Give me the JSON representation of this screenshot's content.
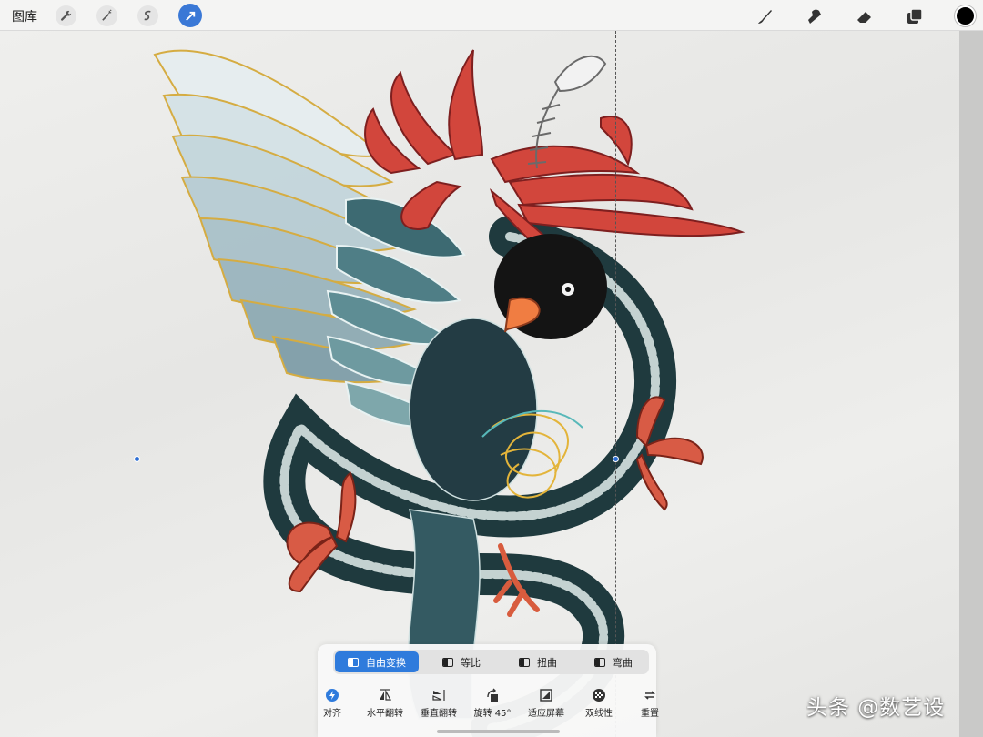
{
  "topbar": {
    "gallery_label": "图库",
    "left_tools": [
      {
        "name": "wrench-icon",
        "active": false
      },
      {
        "name": "magic-wand-icon",
        "active": false
      },
      {
        "name": "selection-icon",
        "active": false
      },
      {
        "name": "transform-arrow-icon",
        "active": true
      }
    ],
    "right_tools": [
      "brush-icon",
      "smudge-icon",
      "eraser-icon",
      "layers-icon"
    ],
    "current_color": "#000000",
    "accent_color": "#2f7bdc"
  },
  "transform": {
    "modes": [
      {
        "label": "自由变换",
        "active": true
      },
      {
        "label": "等比",
        "active": false
      },
      {
        "label": "扭曲",
        "active": false
      },
      {
        "label": "弯曲",
        "active": false
      }
    ],
    "tools": [
      {
        "label": "对齐",
        "icon": "snap-icon"
      },
      {
        "label": "水平翻转",
        "icon": "flip-horizontal-icon"
      },
      {
        "label": "垂直翻转",
        "icon": "flip-vertical-icon"
      },
      {
        "label": "旋转 45°",
        "icon": "rotate-45-icon"
      },
      {
        "label": "适应屏幕",
        "icon": "fit-screen-icon"
      },
      {
        "label": "双线性",
        "icon": "bilinear-icon"
      },
      {
        "label": "重置",
        "icon": "reset-icon"
      }
    ]
  },
  "watermark": "头条 @数艺设"
}
